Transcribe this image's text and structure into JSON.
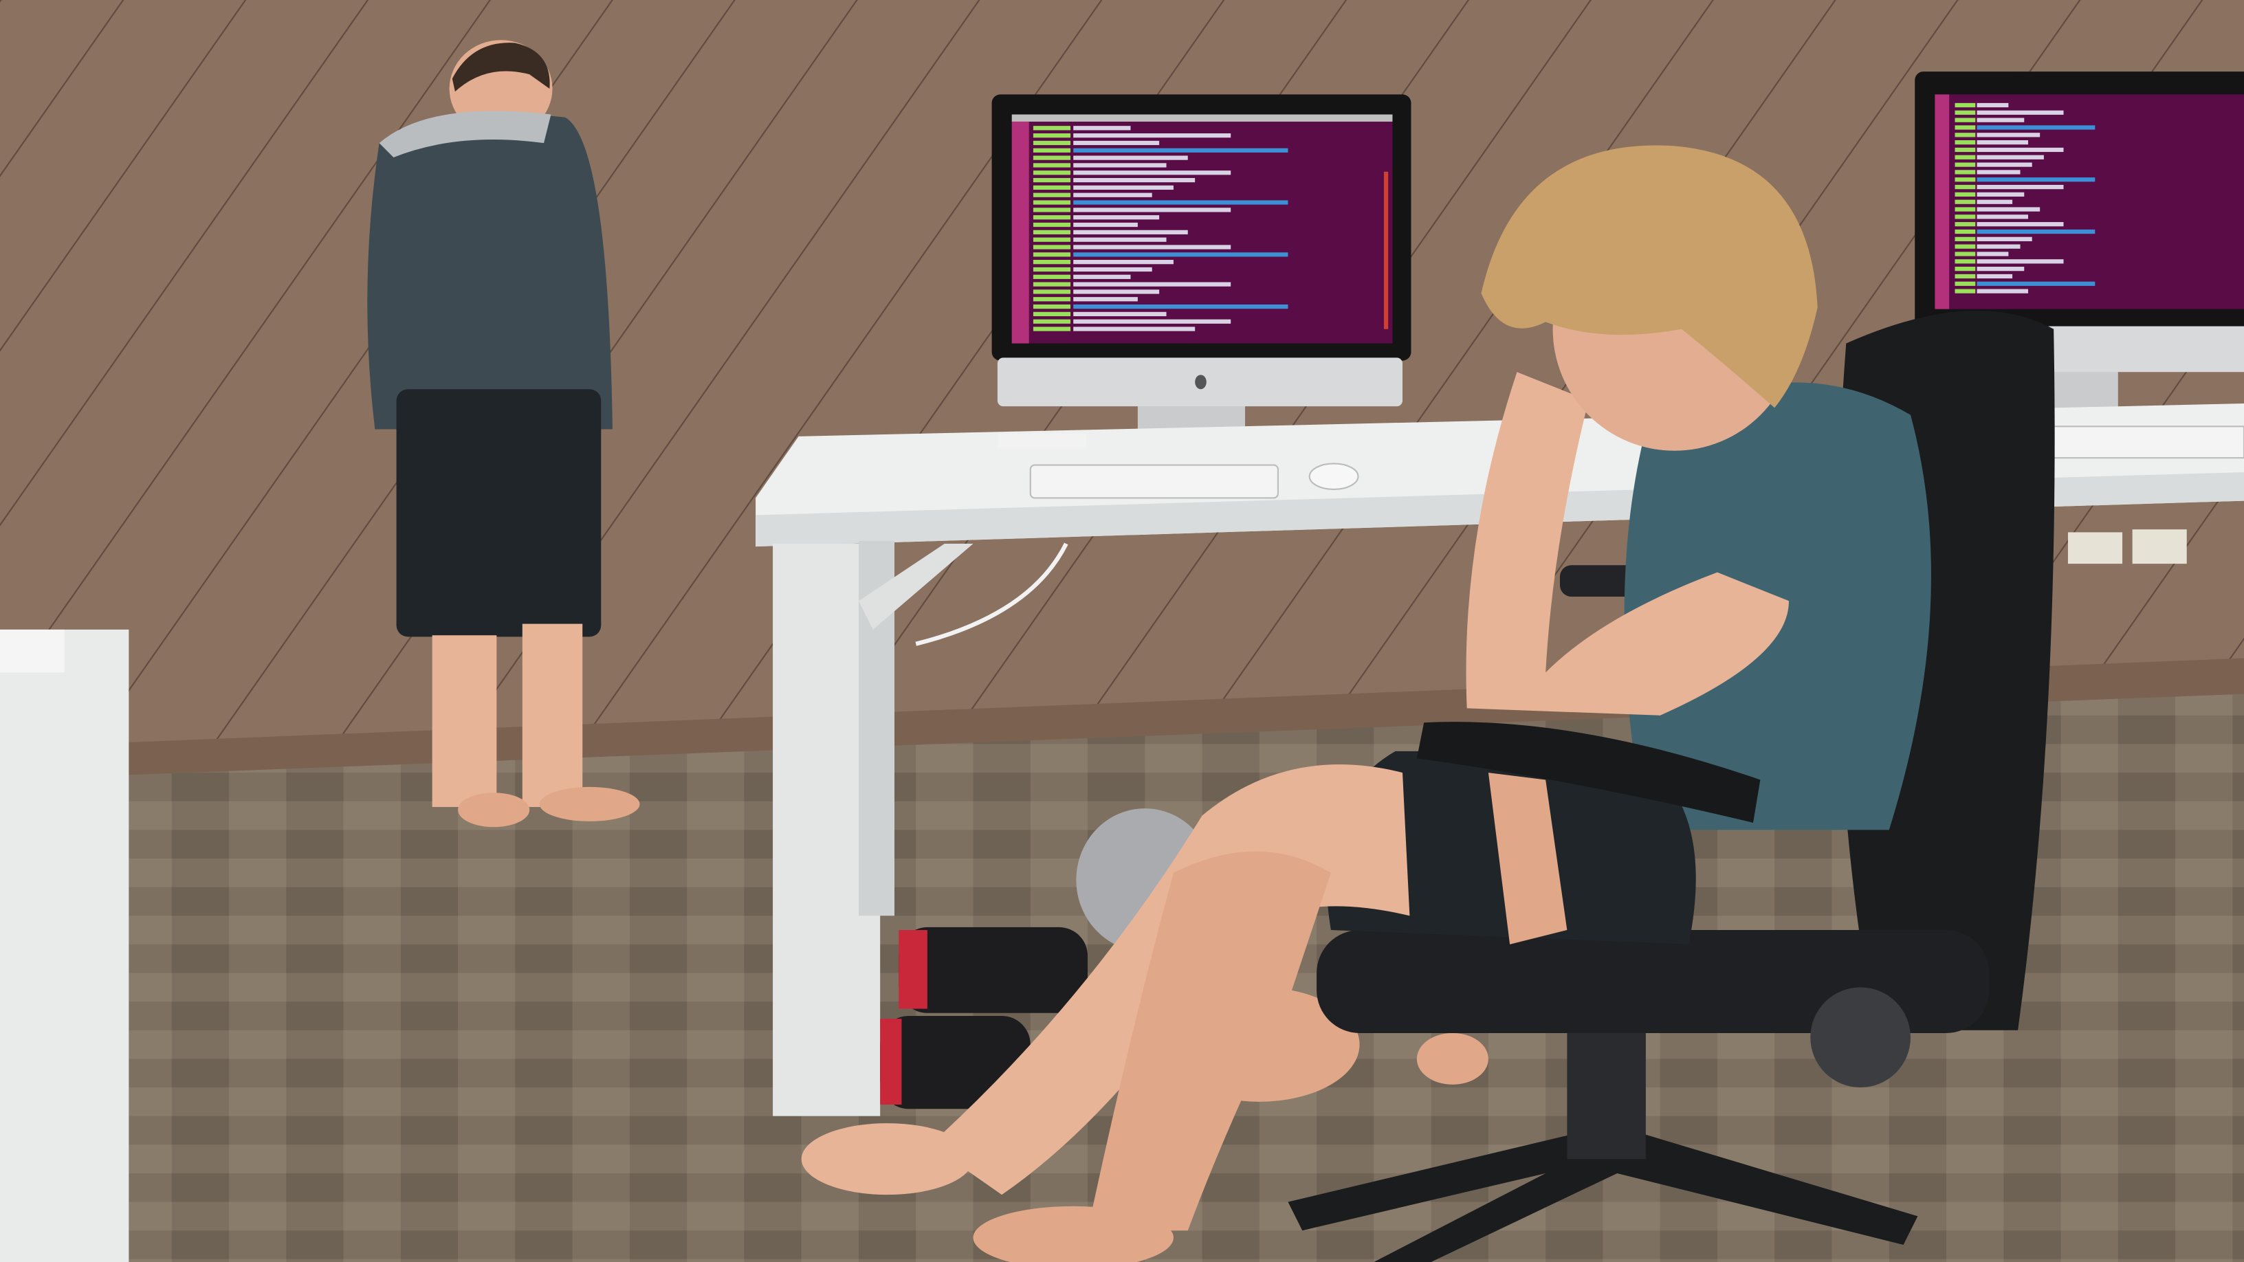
{
  "palette": {
    "wall": "#8b7160",
    "wall_line": "#5e4a3e",
    "baseboard": "#7a6150",
    "carpet": "#7e7061",
    "carpet_dark": "#5f5448",
    "desk": "#eef0ef",
    "bezel": "#141414",
    "terminal": "#5a0c47",
    "terminal_green": "#9be05a",
    "terminal_text": "#d8d2e4",
    "terminal_blue": "#3d8fd6",
    "launcher": "#b3307a",
    "aluminum": "#d7d9db",
    "hoodie": "#3d4a52",
    "shorts": "#1f2528",
    "skin": "#e8b497",
    "hair_blond": "#c9a06a",
    "hair_dark": "#3a2c22",
    "tshirt": "#3f6470",
    "chair": "#1b1c1e",
    "grey_shirt": "#a9abae",
    "shoe_red": "#c8283a"
  }
}
